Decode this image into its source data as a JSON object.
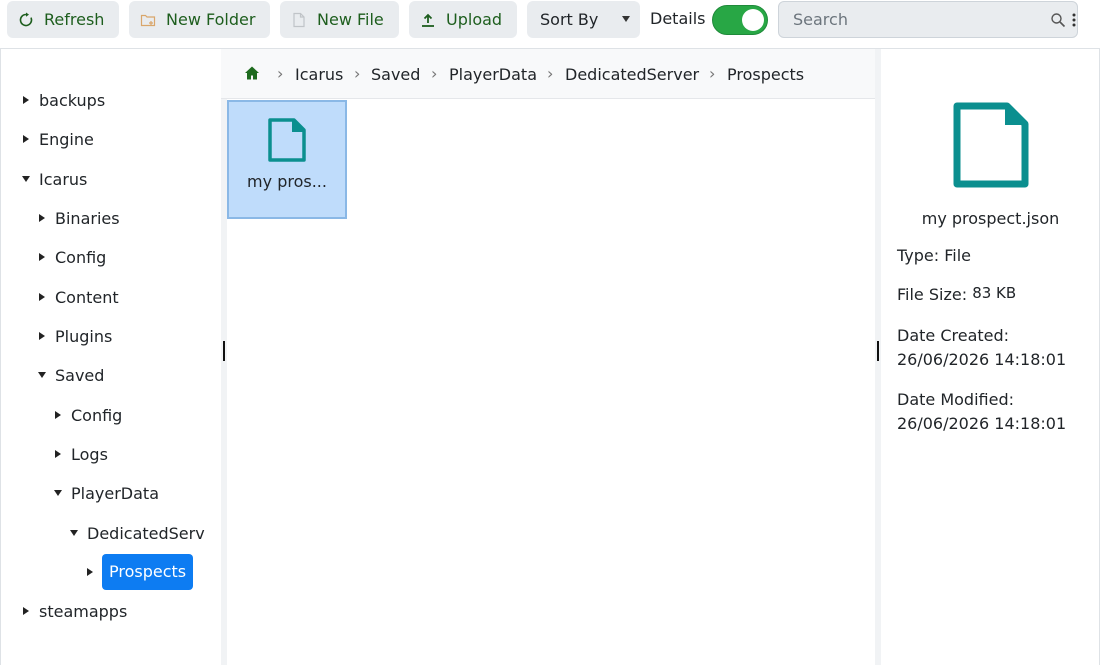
{
  "toolbar": {
    "refresh_label": "Refresh",
    "new_folder_label": "New Folder",
    "new_file_label": "New File",
    "upload_label": "Upload",
    "sort_by_label": "Sort By",
    "details_label": "Details",
    "details_enabled": true,
    "search_placeholder": "Search"
  },
  "tree": {
    "items": [
      {
        "label": "backups",
        "level": 0,
        "expanded": false
      },
      {
        "label": "Engine",
        "level": 0,
        "expanded": false
      },
      {
        "label": "Icarus",
        "level": 0,
        "expanded": true
      },
      {
        "label": "Binaries",
        "level": 1,
        "expanded": false
      },
      {
        "label": "Config",
        "level": 1,
        "expanded": false
      },
      {
        "label": "Content",
        "level": 1,
        "expanded": false
      },
      {
        "label": "Plugins",
        "level": 1,
        "expanded": false
      },
      {
        "label": "Saved",
        "level": 1,
        "expanded": true
      },
      {
        "label": "Config",
        "level": 2,
        "expanded": false
      },
      {
        "label": "Logs",
        "level": 2,
        "expanded": false
      },
      {
        "label": "PlayerData",
        "level": 2,
        "expanded": true
      },
      {
        "label": "DedicatedServ",
        "level": 3,
        "expanded": true
      },
      {
        "label": "Prospects",
        "level": 4,
        "expanded": false,
        "selected": true
      },
      {
        "label": "steamapps",
        "level": 0,
        "expanded": false
      }
    ]
  },
  "breadcrumb": {
    "items": [
      "Icarus",
      "Saved",
      "PlayerData",
      "DedicatedServer",
      "Prospects"
    ]
  },
  "files": [
    {
      "name": "my prospect.json",
      "display_name": "my pros..."
    }
  ],
  "details": {
    "file_name": "my prospect.json",
    "type_label": "Type:",
    "type_value": "File",
    "size_label": "File Size:",
    "size_value": "83 KB",
    "created_label": "Date Created:",
    "created_value": "26/06/2026 14:18:01",
    "modified_label": "Date Modified:",
    "modified_value": "26/06/2026 14:18:01"
  },
  "colors": {
    "accent_green": "#28a745",
    "selected_blue": "#0d7cf2",
    "file_icon_teal": "#0b8f8f",
    "tile_selected_bg": "#bfdcfb"
  }
}
